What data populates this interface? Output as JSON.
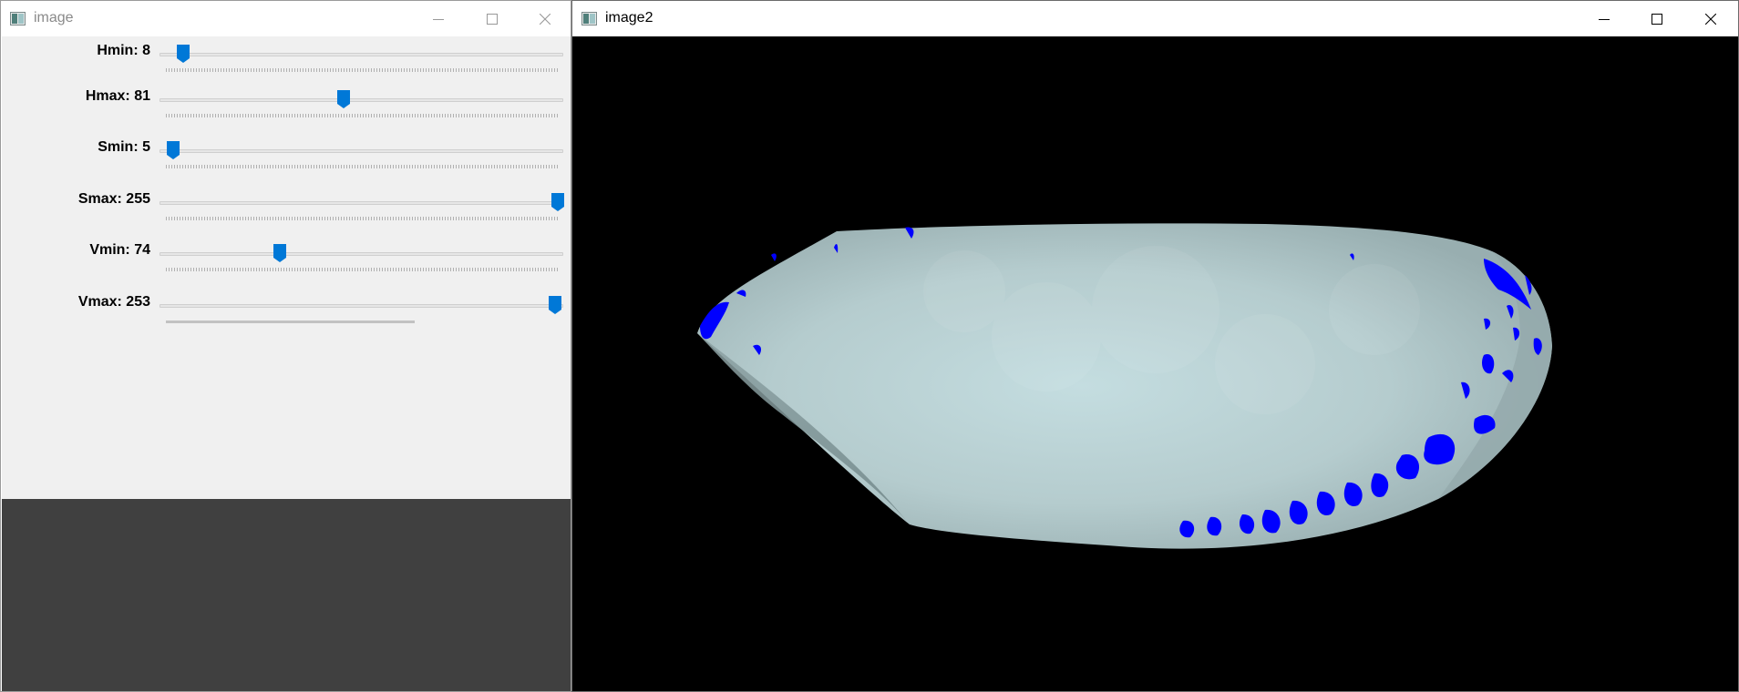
{
  "window1": {
    "title": "image"
  },
  "window2": {
    "title": "image2"
  },
  "trackbars": [
    {
      "label": "Hmin: 8",
      "value": 8,
      "max": 179
    },
    {
      "label": "Hmax: 81",
      "value": 81,
      "max": 179
    },
    {
      "label": "Smin: 5",
      "value": 5,
      "max": 255
    },
    {
      "label": "Smax: 255",
      "value": 255,
      "max": 255
    },
    {
      "label": "Vmin: 74",
      "value": 74,
      "max": 255
    },
    {
      "label": "Vmax: 253",
      "value": 253,
      "max": 255
    }
  ],
  "colors": {
    "thumb": "#0078d7",
    "panel": "#f0f0f0",
    "dark_area": "#404040",
    "mask_blue": "#0000ff",
    "object": "#b7cdd0"
  },
  "icons": {
    "window_icon": "opencv-window-icon",
    "minimize": "minimize-icon",
    "maximize": "maximize-icon",
    "close": "close-icon"
  }
}
